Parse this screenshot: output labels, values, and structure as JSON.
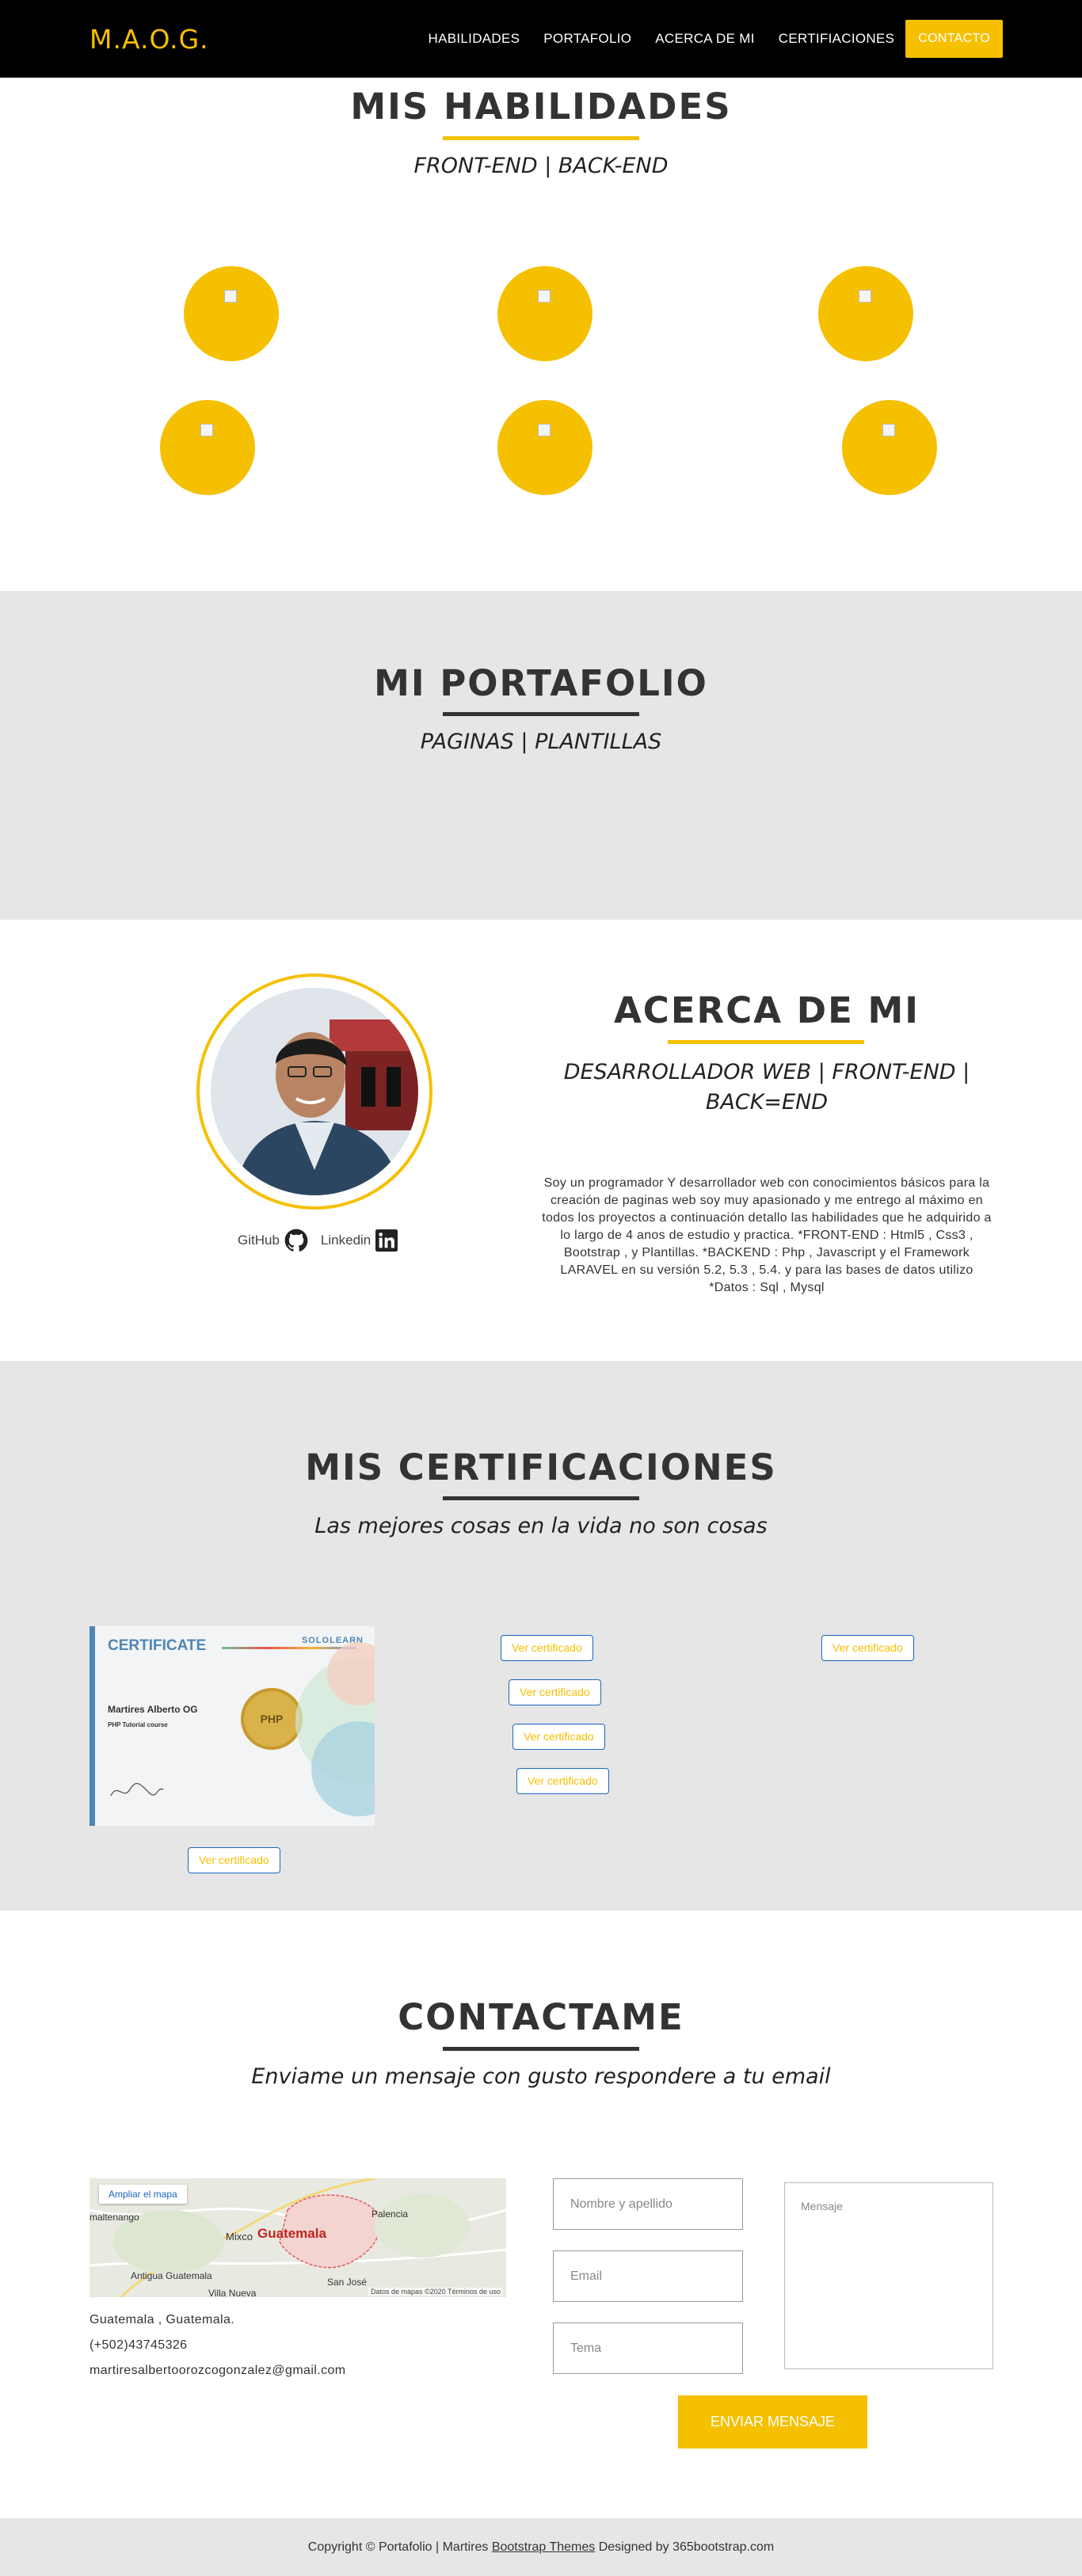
{
  "nav": {
    "brand": "M.A.O.G.",
    "items": [
      "HABILIDADES",
      "PORTAFOLIO",
      "ACERCA DE MI",
      "CERTIFIACIONES"
    ],
    "cta": "CONTACTO"
  },
  "skills": {
    "title": "MIS HABILIDADES",
    "subtitle": "FRONT-END | BACK-END",
    "icons": [
      "broken-image-icon",
      "broken-image-icon",
      "broken-image-icon",
      "broken-image-icon",
      "broken-image-icon",
      "broken-image-icon"
    ]
  },
  "portfolio": {
    "title": "MI PORTAFOLIO",
    "subtitle": "PAGINAS | PLANTILLAS"
  },
  "about": {
    "title": "ACERCA DE MI",
    "subtitle": "DESARROLLADOR WEB | FRONT-END | BACK=END",
    "text": "Soy un programador Y desarrollador web con conocimientos básicos para la creación de paginas web soy muy apasionado y me entrego al máximo en todos los proyectos a continuación detallo las habilidades que he adquirido a lo largo de 4 anos de estudio y practica. *FRONT-END : Html5 , Css3 , Bootstrap , y Plantillas. *BACKEND : Php , Javascript y el Framework LARAVEL en su versión 5.2, 5.3 , 5.4. y para las bases de datos utilizo *Datos : Sql , Mysql",
    "github_label": "GitHub",
    "linkedin_label": "Linkedin"
  },
  "certs": {
    "title": "MIS CERTIFICACIONES",
    "subtitle": "Las mejores cosas en la vida no son cosas",
    "button_label": "Ver certificado",
    "certificate": {
      "heading": "CERTIFICATE",
      "issuer": "SOLOLEARN",
      "name": "Martires Alberto OG",
      "course": "PHP Tutorial course",
      "seal": "PHP"
    }
  },
  "contact": {
    "title": "CONTACTAME",
    "subtitle": "Enviame un mensaje con gusto respondere a tu email",
    "map_button": "Ampliar el mapa",
    "map_label": "Guatemala",
    "map_places": [
      "Palencia",
      "Mixco",
      "Antigua Guatemala",
      "Villa Nueva",
      "San José",
      "maltenango"
    ],
    "map_credit": "Datos de mapas ©2020   Términos de uso",
    "location": "Guatemala , Guatemala.",
    "phone": "(+502)43745326",
    "email": "martiresalbertoorozcogonzalez@gmail.com",
    "placeholders": {
      "name": "Nombre y apellido",
      "email": "Email",
      "subject": "Tema",
      "message": "Mensaje"
    },
    "send": "ENVIAR MENSAJE"
  },
  "footer": {
    "prefix": "Copyright © Portafolio | Martires",
    "link": "Bootstrap Themes",
    "suffix": "Designed by 365bootstrap.com"
  },
  "colors": {
    "accent": "#f5c000",
    "nav_bg": "#000000",
    "band_bg": "#e6e6e6",
    "button_border": "#1a66c0"
  }
}
